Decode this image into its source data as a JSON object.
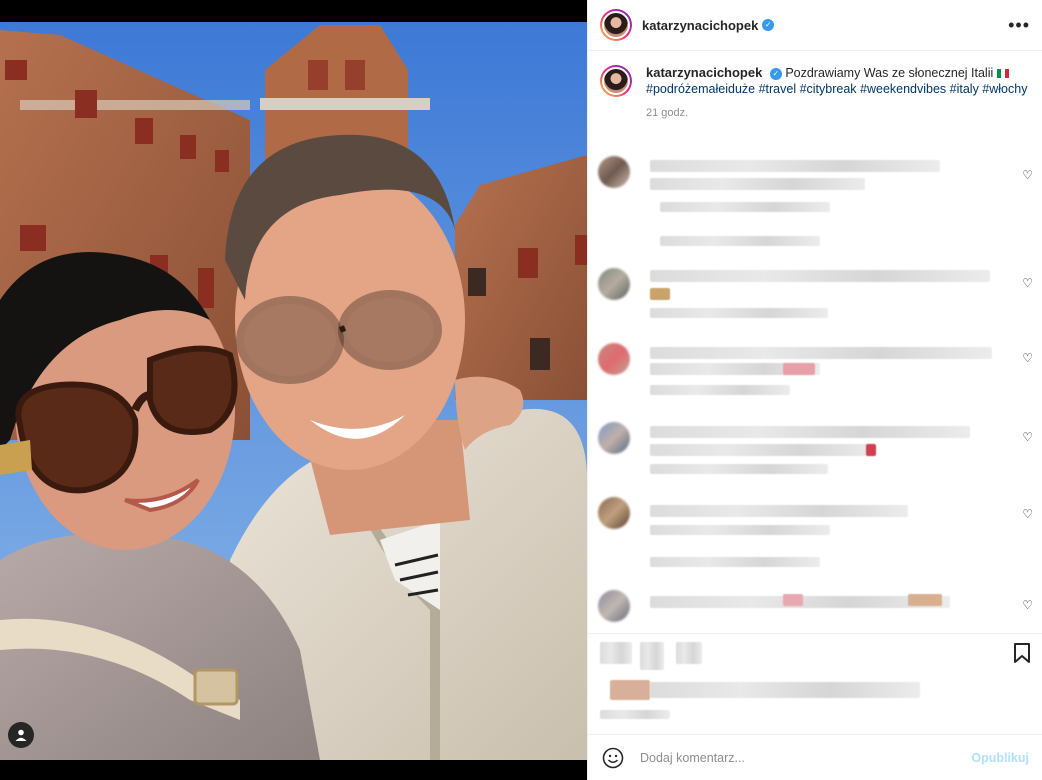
{
  "post": {
    "username": "katarzynacichopek",
    "more_label": "•••"
  },
  "caption": {
    "username": "katarzynacichopek",
    "text": "Pozdrawiamy Was ze słonecznej Italii",
    "hashtags": "#podróżemałeiduże #travel #citybreak #weekendvibes #italy #włochy",
    "time": "21 godz."
  },
  "comment_box": {
    "placeholder": "Dodaj komentarz...",
    "publish_label": "Opublikuj"
  },
  "icons": {
    "verified": "verified-badge-icon",
    "heart": "heart-icon",
    "bookmark": "bookmark-icon",
    "emoji": "emoji-icon",
    "user": "user-tag-icon",
    "more": "more-options-icon"
  },
  "colors": {
    "verified": "#3897f0",
    "hashtag": "#00376b",
    "publish": "#b2dffc"
  }
}
